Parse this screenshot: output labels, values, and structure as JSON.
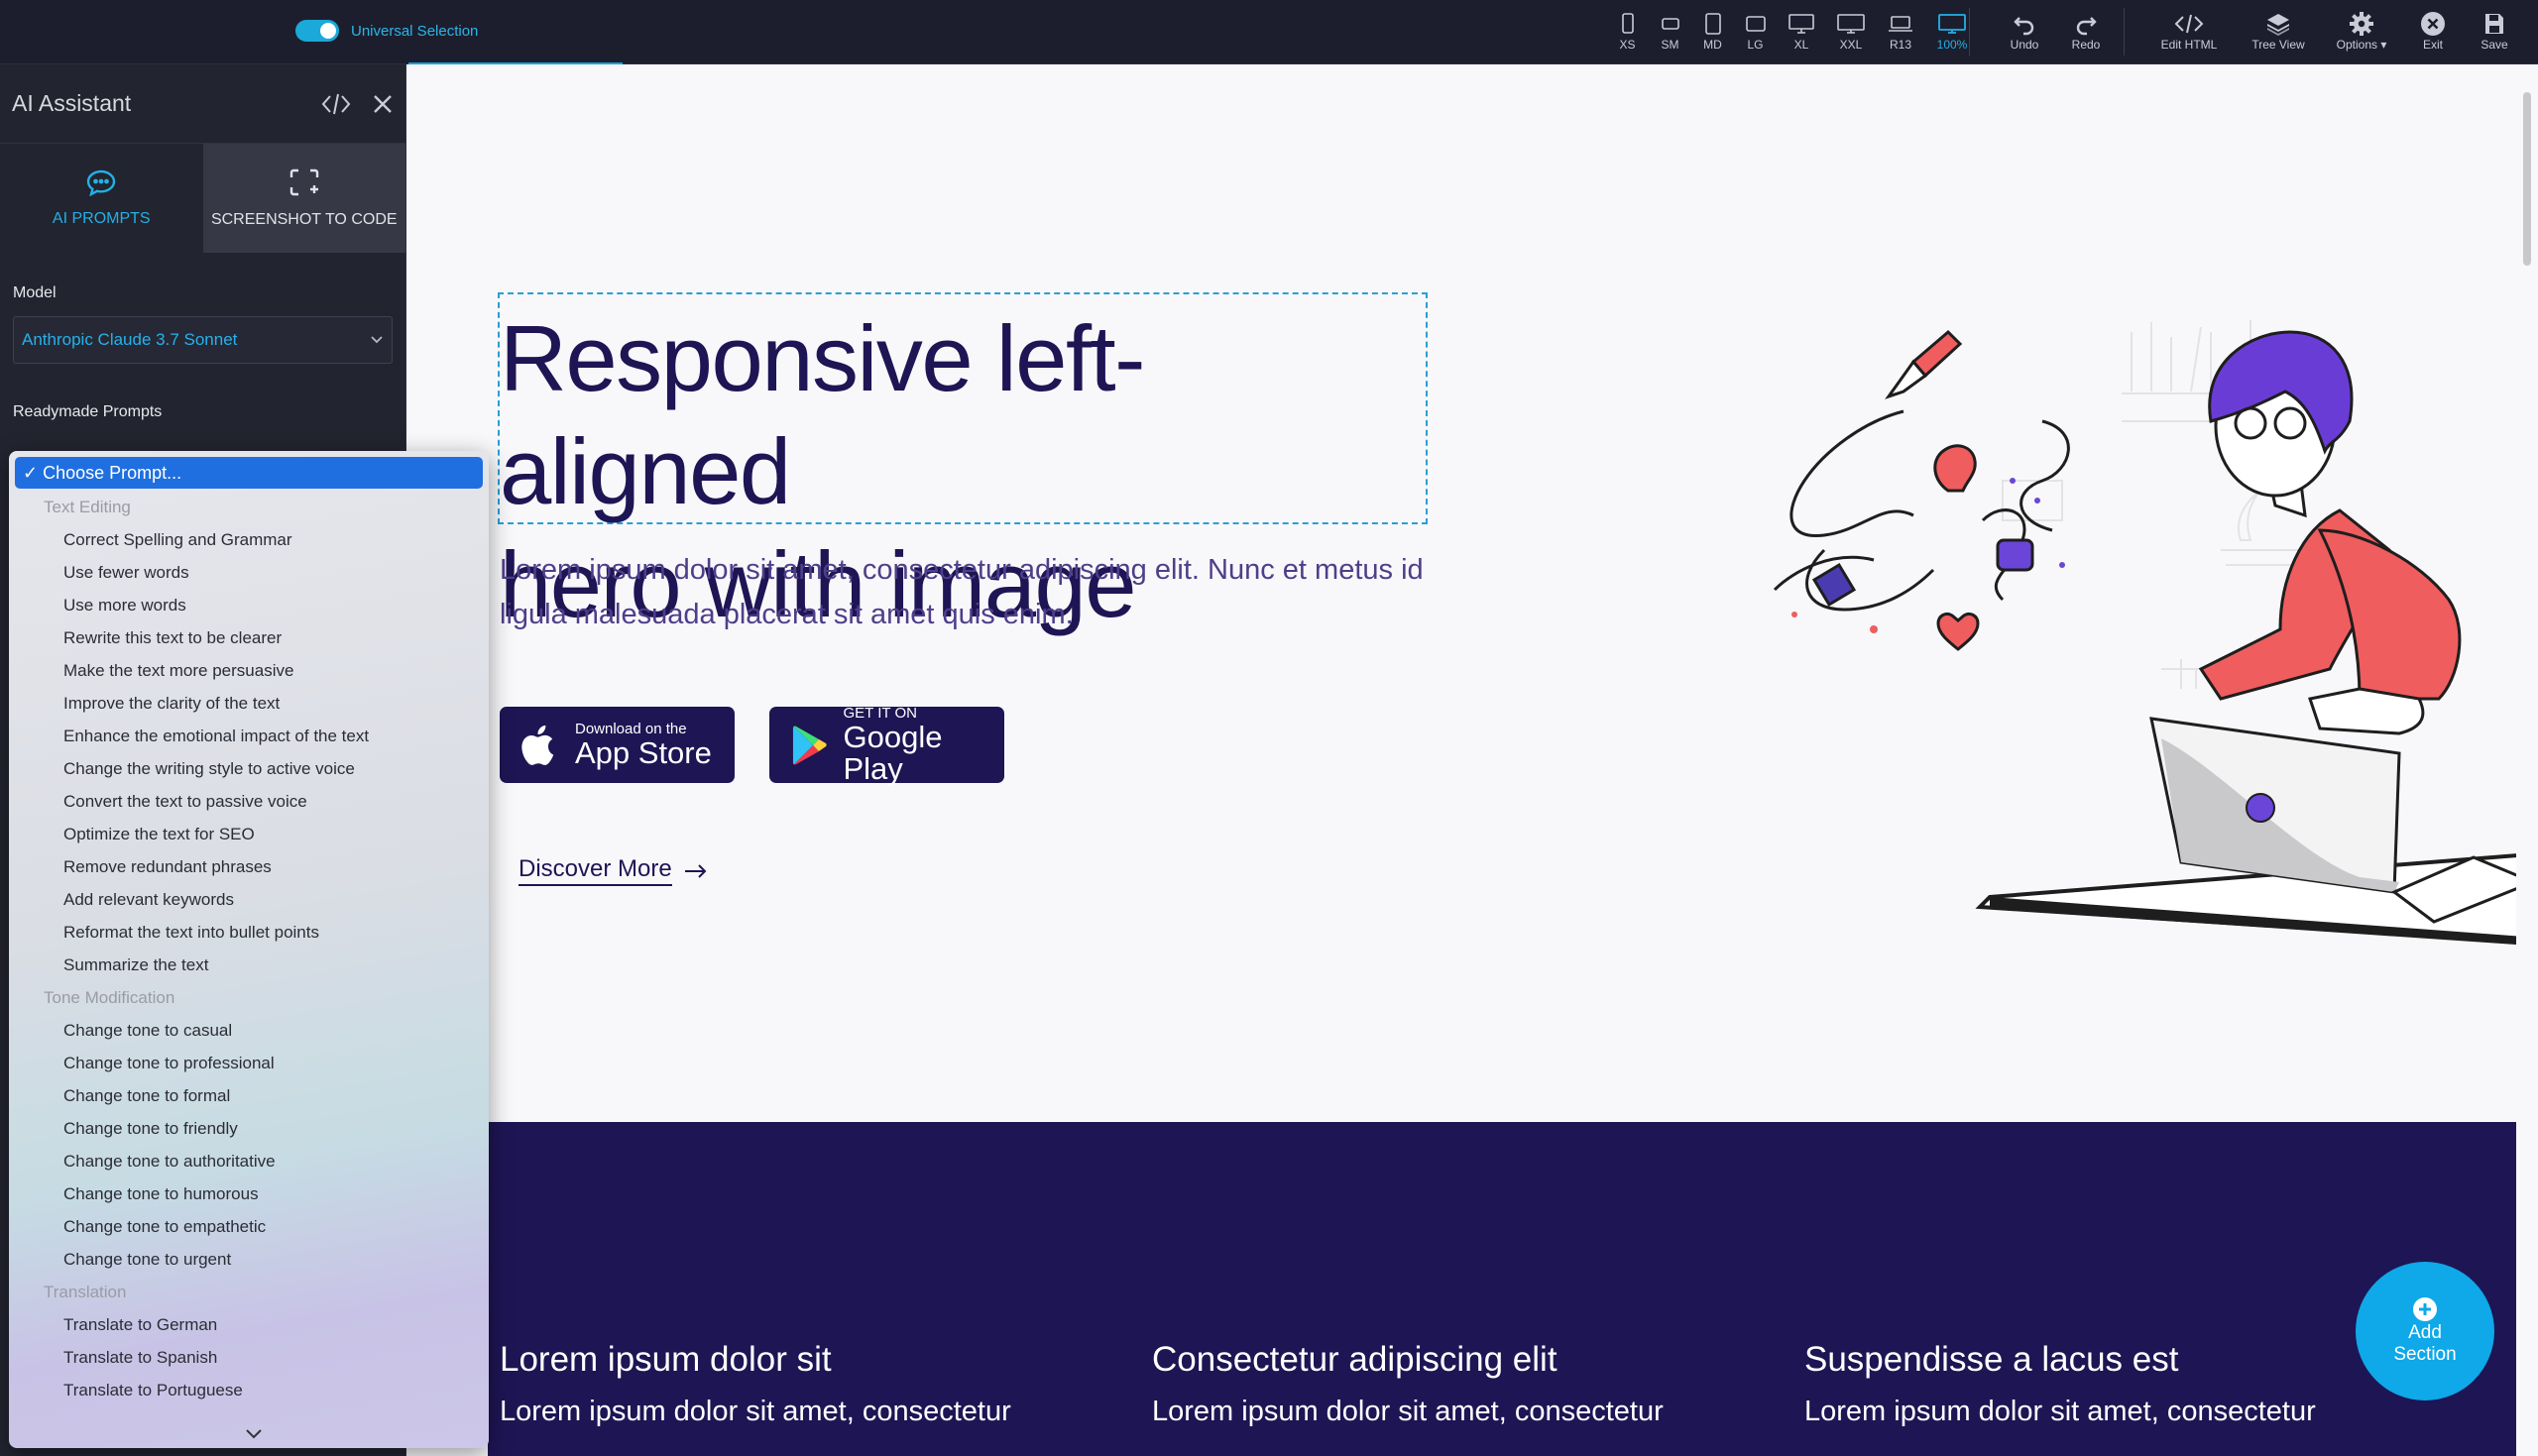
{
  "toolbar": {
    "universal_selection_label": "Universal Selection",
    "devices": [
      {
        "label": "XS",
        "icon": "phone-icon"
      },
      {
        "label": "SM",
        "icon": "phone-landscape-icon"
      },
      {
        "label": "MD",
        "icon": "tablet-icon"
      },
      {
        "label": "LG",
        "icon": "tablet-landscape-icon"
      },
      {
        "label": "XL",
        "icon": "desktop-icon"
      },
      {
        "label": "XXL",
        "icon": "monitor-icon"
      },
      {
        "label": "R13",
        "icon": "laptop-icon"
      },
      {
        "label": "100%",
        "icon": "full-monitor-icon",
        "active": true
      }
    ],
    "undo_label": "Undo",
    "redo_label": "Redo",
    "edit_html_label": "Edit HTML",
    "tree_view_label": "Tree View",
    "options_label": "Options ▾",
    "exit_label": "Exit",
    "save_label": "Save",
    "accent_color": "#23b0e6"
  },
  "sidebar": {
    "title": "AI Assistant",
    "tabs": [
      {
        "label": "AI PROMPTS",
        "icon": "chat-icon",
        "active": true
      },
      {
        "label": "SCREENSHOT TO CODE",
        "icon": "screenshot-icon",
        "active": false
      }
    ],
    "model_label": "Model",
    "model_value": "Anthropic Claude 3.7 Sonnet",
    "prompts_label": "Readymade Prompts"
  },
  "prompt_dropdown": {
    "selected": "✓ Choose Prompt...",
    "groups": [
      {
        "label": "Text Editing",
        "options": [
          "Correct Spelling and Grammar",
          "Use fewer words",
          "Use more words",
          "Rewrite this text to be clearer",
          "Make the text more persuasive",
          "Improve the clarity of the text",
          "Enhance the emotional impact of the text",
          "Change the writing style to active voice",
          "Convert the text to passive voice",
          "Optimize the text for SEO",
          "Remove redundant phrases",
          "Add relevant keywords",
          "Reformat the text into bullet points",
          "Summarize the text"
        ]
      },
      {
        "label": "Tone Modification",
        "options": [
          "Change tone to casual",
          "Change tone to professional",
          "Change tone to formal",
          "Change tone to friendly",
          "Change tone to authoritative",
          "Change tone to humorous",
          "Change tone to empathetic",
          "Change tone to urgent"
        ]
      },
      {
        "label": "Translation",
        "options": [
          "Translate to German",
          "Translate to Spanish",
          "Translate to Portuguese"
        ]
      }
    ]
  },
  "hero": {
    "title_line1": "Responsive left-aligned",
    "title_line2": "hero with image",
    "subtitle": "Lorem ipsum dolor sit amet, consectetur adipiscing elit. Nunc et metus id ligula malesuada placerat sit amet quis enim.",
    "app_store": {
      "small": "Download on the",
      "big": "App Store"
    },
    "google_play": {
      "small": "GET IT ON",
      "big": "Google Play"
    },
    "discover_label": "Discover More",
    "title_color": "#1e1554"
  },
  "features": [
    {
      "title": "Lorem ipsum dolor sit",
      "text": "Lorem ipsum dolor sit amet, consectetur"
    },
    {
      "title": "Consectetur adipiscing elit",
      "text": "Lorem ipsum dolor sit amet, consectetur"
    },
    {
      "title": "Suspendisse a lacus est",
      "text": "Lorem ipsum dolor sit amet, consectetur"
    }
  ],
  "add_section": {
    "line1": "Add",
    "line2": "Section"
  }
}
